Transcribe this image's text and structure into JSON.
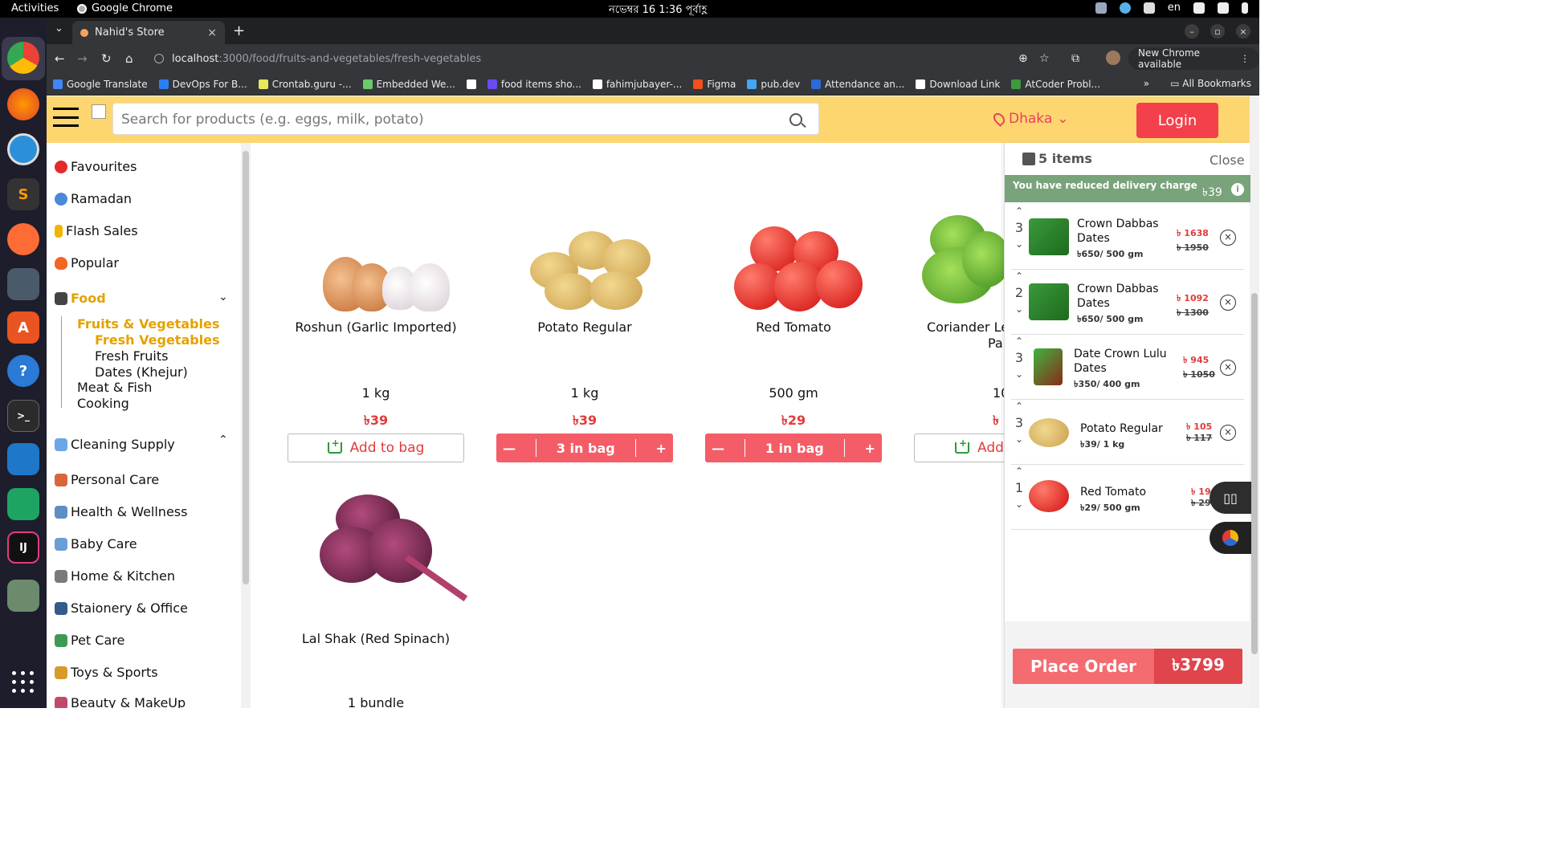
{
  "os": {
    "activities": "Activities",
    "app_name": "Google Chrome",
    "clock": "নভেম্বর 16  1:36 পূর্বাহ্ণ",
    "lang": "en"
  },
  "browser": {
    "tab_title": "Nahid's Store",
    "url_host": "localhost",
    "url_path": ":3000/food/fruits-and-vegetables/fresh-vegetables",
    "new_chrome": "New Chrome available",
    "bookmarks": [
      {
        "label": "Google Translate",
        "color": "#4285f4"
      },
      {
        "label": "DevOps For B...",
        "color": "#2d7df6"
      },
      {
        "label": "Crontab.guru -...",
        "color": "#e8e85c"
      },
      {
        "label": "Embedded We...",
        "color": "#6bc96b"
      },
      {
        "label": "",
        "color": "#ffffff"
      },
      {
        "label": "food items sho...",
        "color": "#6a4bf0"
      },
      {
        "label": "fahimjubayer-...",
        "color": "#ffffff"
      },
      {
        "label": "Figma",
        "color": "#f24e1e"
      },
      {
        "label": "pub.dev",
        "color": "#42a5f5"
      },
      {
        "label": "Attendance an...",
        "color": "#2a6bd6"
      },
      {
        "label": "Download Link",
        "color": "#ffffff"
      },
      {
        "label": "AtCoder Probl...",
        "color": "#3d9a3d"
      }
    ],
    "all_bookmarks": "All Bookmarks",
    "more": "»"
  },
  "header": {
    "search_placeholder": "Search for products (e.g. eggs, milk, potato)",
    "location": "Dhaka",
    "login": "Login"
  },
  "sidebar": {
    "categories": [
      {
        "label": "Favourites",
        "color": "#e32b2b"
      },
      {
        "label": "Ramadan",
        "color": "#4a8ad9"
      },
      {
        "label": "Flash Sales",
        "color": "#f5b400"
      },
      {
        "label": "Popular",
        "color": "#f26522"
      },
      {
        "label": "Food",
        "color": "#444444"
      },
      {
        "label": "Cleaning Supply",
        "color": "#6aa6e8"
      },
      {
        "label": "Personal Care",
        "color": "#d8663d"
      },
      {
        "label": "Health & Wellness",
        "color": "#5c8fc2"
      },
      {
        "label": "Baby Care",
        "color": "#6a9ed6"
      },
      {
        "label": "Home & Kitchen",
        "color": "#7a7a7a"
      },
      {
        "label": "Staionery & Office",
        "color": "#355b8a"
      },
      {
        "label": "Pet Care",
        "color": "#3c9a52"
      },
      {
        "label": "Toys & Sports",
        "color": "#d79a2b"
      },
      {
        "label": "Beauty & MakeUp",
        "color": "#c04a6a"
      }
    ],
    "food_sub": {
      "fruits_veg": "Fruits & Vegetables",
      "fresh_veg": "Fresh Vegetables",
      "fresh_fruits": "Fresh Fruits",
      "dates": "Dates (Khejur)",
      "meat_fish": "Meat & Fish",
      "cooking": "Cooking"
    }
  },
  "products": [
    {
      "name": "Roshun (Garlic Imported)",
      "unit": "1 kg",
      "price": "৳39",
      "action": "Add to bag"
    },
    {
      "name": "Potato Regular",
      "unit": "1 kg",
      "price": "৳39",
      "in_bag": "3 in bag"
    },
    {
      "name": "Red Tomato",
      "unit": "500 gm",
      "price": "৳29",
      "in_bag": "1 in bag"
    },
    {
      "name": "Coriander Le",
      "name_line2": "Pa",
      "unit": "100",
      "price": "৳",
      "action": "Add"
    },
    {
      "name": "Lal Shak (Red Spinach)",
      "unit": "1 bundle"
    }
  ],
  "cart": {
    "count": "5 items",
    "close": "Close",
    "delivery_text": "You have reduced delivery charge",
    "delivery_amount": "৳39",
    "items": [
      {
        "qty": "3",
        "name": "Crown Dabbas Dates",
        "unit": "৳650/ 500 gm",
        "price": "৳ 1638",
        "old": "৳ 1950"
      },
      {
        "qty": "2",
        "name": "Crown Dabbas Dates",
        "unit": "৳650/ 500 gm",
        "price": "৳ 1092",
        "old": "৳ 1300"
      },
      {
        "qty": "3",
        "name": "Date Crown Lulu Dates",
        "unit": "৳350/ 400 gm",
        "price": "৳ 945",
        "old": "৳ 1050"
      },
      {
        "qty": "3",
        "name": "Potato Regular",
        "unit": "৳39/ 1 kg",
        "price": "৳ 105",
        "old": "৳ 117"
      },
      {
        "qty": "1",
        "name": "Red Tomato",
        "unit": "৳29/ 500 gm",
        "price": "৳ 19",
        "old": "৳ 29"
      }
    ],
    "place_order": "Place Order",
    "total": "৳3799"
  }
}
